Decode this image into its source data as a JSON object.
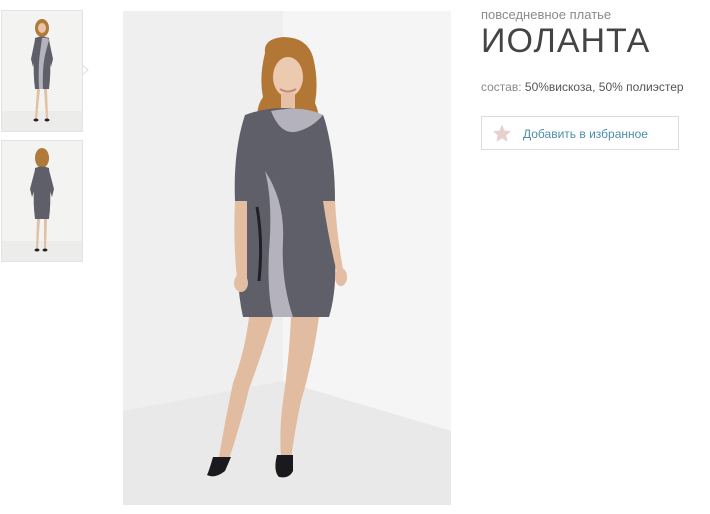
{
  "product": {
    "category": "повседневное платье",
    "title": "ИОЛАНТА",
    "composition_label": "состав:",
    "composition_value": "50%вискоза, 50% полиэстер"
  },
  "actions": {
    "favorite_label": "Добавить в избранное"
  },
  "gallery": {
    "thumbnails": [
      "front-view",
      "back-view"
    ],
    "selected": 0
  },
  "colors": {
    "dress": "#5e5f68",
    "dress_panel": "#b4b2bc",
    "accent_link": "#4b8fa6",
    "star": "#e8cfd0"
  }
}
